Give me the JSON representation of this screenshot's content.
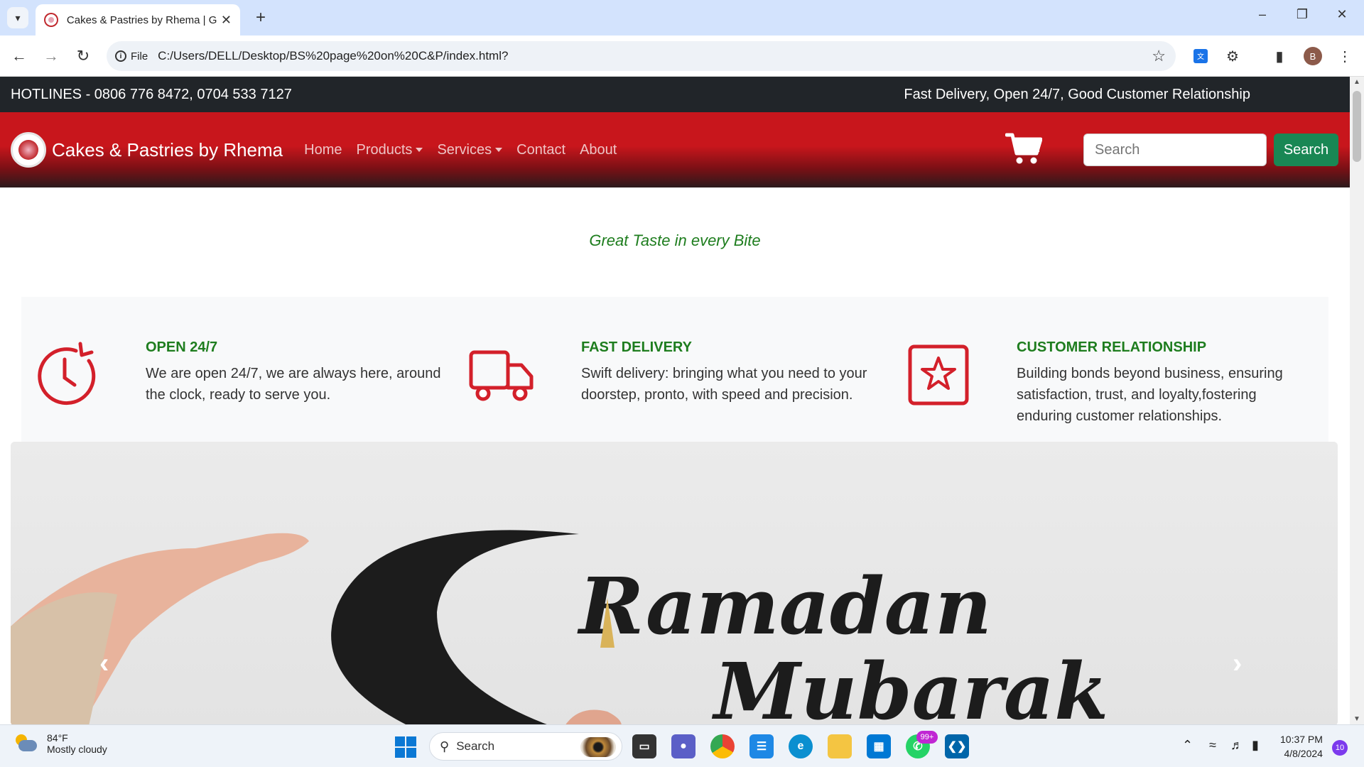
{
  "browser": {
    "tab_title": "Cakes & Pastries by Rhema | Gr",
    "file_label": "File",
    "url": "C:/Users/DELL/Desktop/BS%20page%20on%20C&P/index.html?",
    "avatar_letter": "B"
  },
  "topbar": {
    "hotlines": "HOTLINES - 0806 776 8472, 0704 533 7127",
    "features": "Fast Delivery, Open 24/7, Good Customer Relationship"
  },
  "navbar": {
    "brand": "Cakes & Pastries by Rhema",
    "links": [
      "Home",
      "Products",
      "Services",
      "Contact",
      "About"
    ],
    "search_placeholder": "Search",
    "search_button": "Search"
  },
  "tagline": "Great Taste in every Bite",
  "features": [
    {
      "icon": "clock-icon",
      "heading": "OPEN 24/7",
      "text": "We are open 24/7, we are always here, around the clock, ready to serve you."
    },
    {
      "icon": "truck-icon",
      "heading": "FAST DELIVERY",
      "text": "Swift delivery: bringing what you need to your doorstep, pronto, with speed and precision."
    },
    {
      "icon": "star-icon",
      "heading": "CUSTOMER RELATIONSHIP",
      "text": "Building bonds beyond business, ensuring satisfaction, trust, and loyalty,fostering enduring customer relationships."
    }
  ],
  "carousel": {
    "image_text_line1": "Ramadan",
    "image_text_line2": "Mubarak"
  },
  "taskbar": {
    "temp": "84°F",
    "condition": "Mostly cloudy",
    "search": "Search",
    "whatsapp_badge": "99+",
    "time": "10:37 PM",
    "date": "4/8/2024",
    "notifications": "10"
  },
  "colors": {
    "navbar_red": "#c8161c",
    "topbar_dark": "#212529",
    "accent_green": "#1e7d1e",
    "search_button_green": "#198754"
  }
}
